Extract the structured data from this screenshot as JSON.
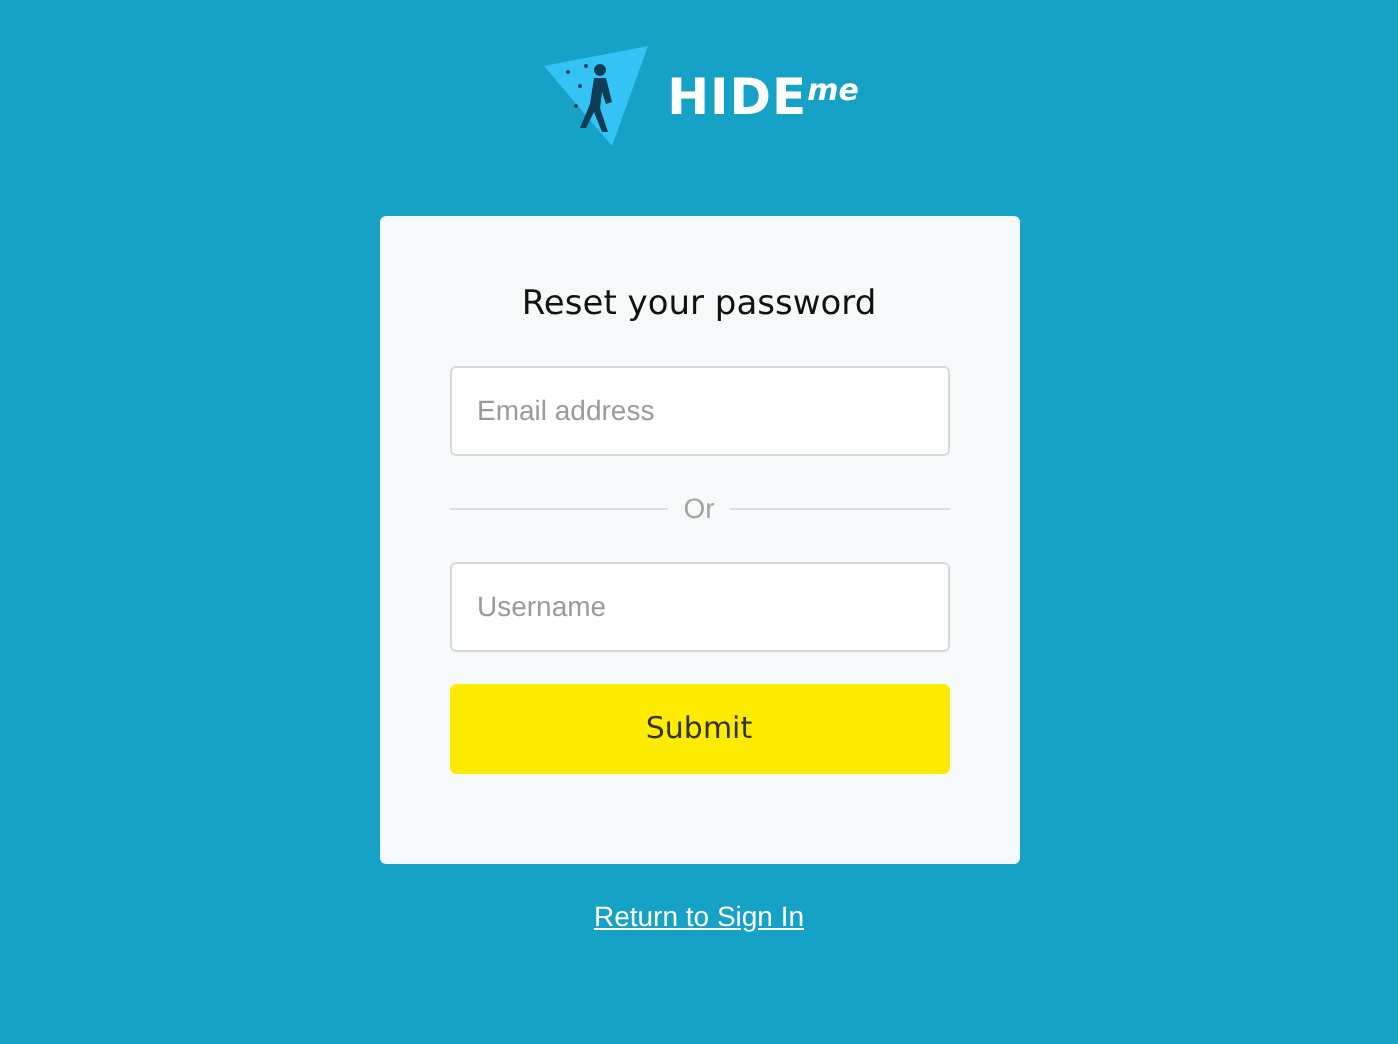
{
  "logo": {
    "word": "HIDE",
    "suffix": "me"
  },
  "form": {
    "title": "Reset your password",
    "email": {
      "placeholder": "Email address"
    },
    "divider": "Or",
    "username": {
      "placeholder": "Username"
    },
    "submit": "Submit"
  },
  "footer_link": "Return to Sign In"
}
